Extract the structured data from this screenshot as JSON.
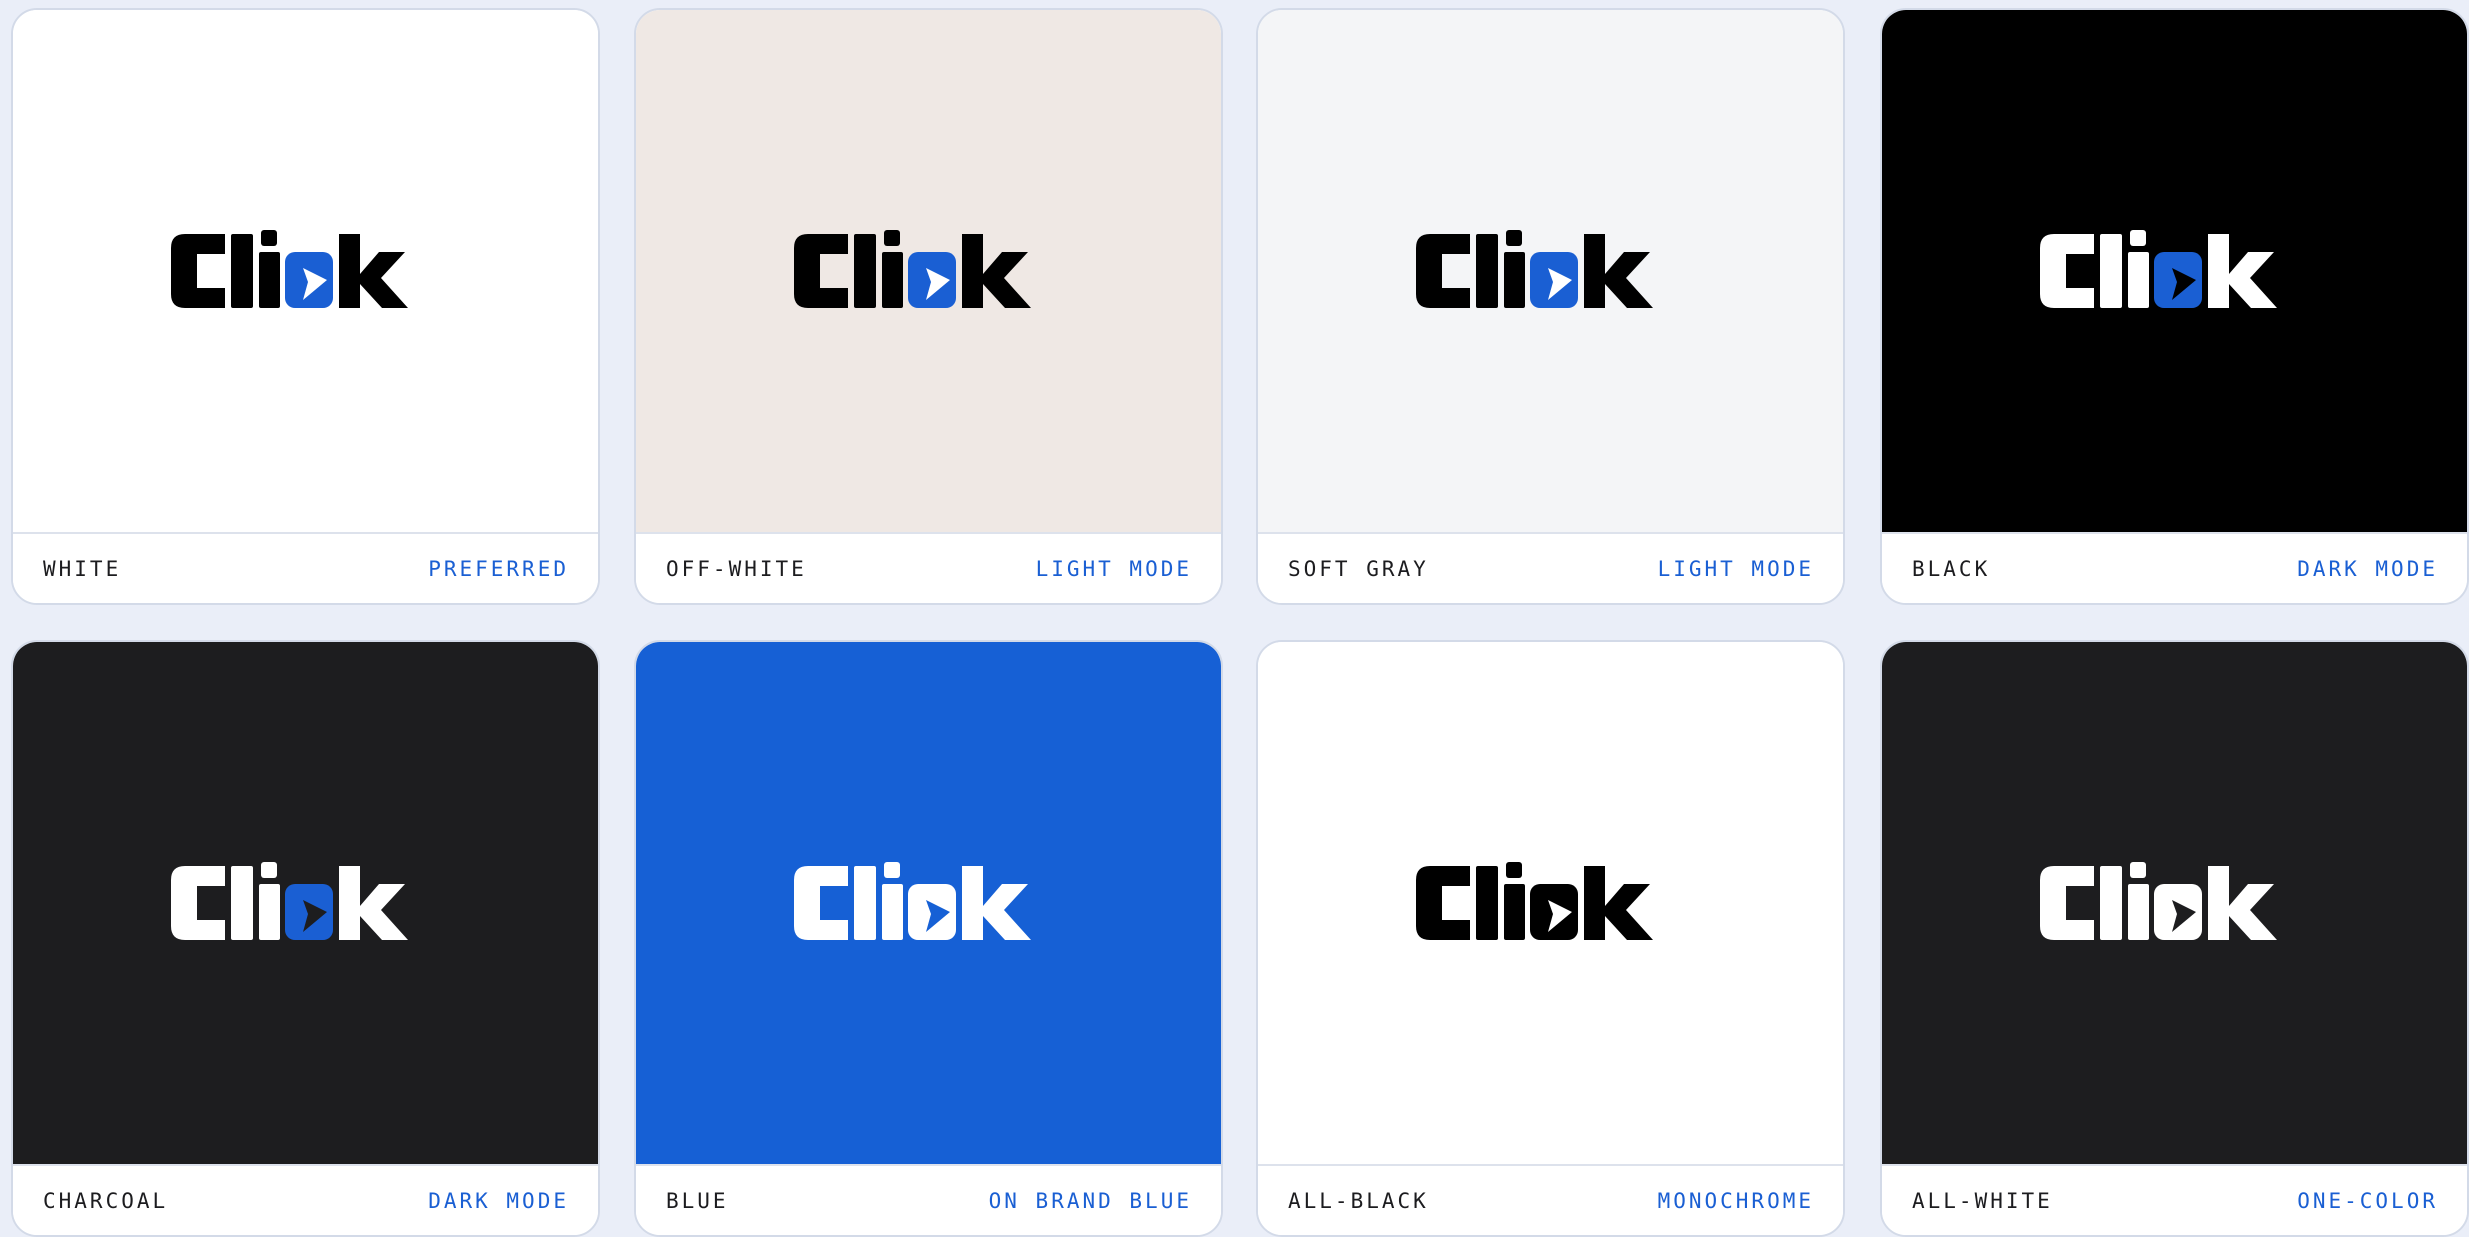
{
  "brand": {
    "wordmark": "Click",
    "accent": "#1a5fd3"
  },
  "swatches": [
    {
      "name": "WHITE",
      "tag": "PREFERRED",
      "bg": "#ffffff",
      "text_color": "#000000",
      "mark_color": "#1a5fd3",
      "arrow_color": "#ffffff"
    },
    {
      "name": "OFF-WHITE",
      "tag": "LIGHT MODE",
      "bg": "#efe8e4",
      "text_color": "#000000",
      "mark_color": "#1a5fd3",
      "arrow_color": "#ffffff"
    },
    {
      "name": "SOFT GRAY",
      "tag": "LIGHT MODE",
      "bg": "#f4f5f7",
      "text_color": "#000000",
      "mark_color": "#1a5fd3",
      "arrow_color": "#ffffff"
    },
    {
      "name": "BLACK",
      "tag": "DARK MODE",
      "bg": "#000000",
      "text_color": "#ffffff",
      "mark_color": "#1a5fd3",
      "arrow_color": "#000000"
    },
    {
      "name": "CHARCOAL",
      "tag": "DARK MODE",
      "bg": "#1d1d1f",
      "text_color": "#ffffff",
      "mark_color": "#1a5fd3",
      "arrow_color": "#1d1d1f"
    },
    {
      "name": "BLUE",
      "tag": "ON BRAND BLUE",
      "bg": "#1660d5",
      "text_color": "#ffffff",
      "mark_color": "#ffffff",
      "arrow_color": "#1660d5"
    },
    {
      "name": "ALL-BLACK",
      "tag": "MONOCHROME",
      "bg": "#ffffff",
      "text_color": "#000000",
      "mark_color": "#000000",
      "arrow_color": "#ffffff"
    },
    {
      "name": "ALL-WHITE",
      "tag": "ONE-COLOR",
      "bg": "#1d1d1f",
      "text_color": "#ffffff",
      "mark_color": "#ffffff",
      "arrow_color": "#1d1d1f"
    }
  ]
}
